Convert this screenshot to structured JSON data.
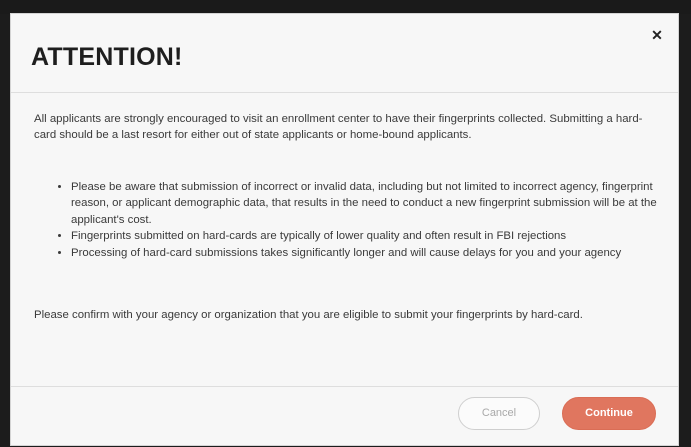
{
  "dialog": {
    "title": "ATTENTION!",
    "close_icon": "close-icon",
    "intro": "All applicants are strongly encouraged to visit an enrollment center to have their fingerprints collected. Submitting a hard-card should be a last resort for either out of state applicants or home-bound applicants.",
    "bullets": [
      "Please be aware that submission of incorrect or invalid data, including but not limited to incorrect agency, fingerprint reason, or applicant demographic data, that results in the need to conduct a new fingerprint submission will be at the applicant's cost.",
      "Fingerprints submitted on hard-cards are typically of lower quality and often result in FBI rejections",
      "Processing of hard-card submissions takes significantly longer and will cause delays for you and your agency"
    ],
    "confirm": "Please confirm with your agency or organization that you are eligible to submit your fingerprints by hard-card.",
    "buttons": {
      "cancel": "Cancel",
      "continue": "Continue"
    }
  },
  "colors": {
    "accent": "#e0765f",
    "modal_bg": "#f7f7f7",
    "backdrop": "#1c1c1c"
  }
}
